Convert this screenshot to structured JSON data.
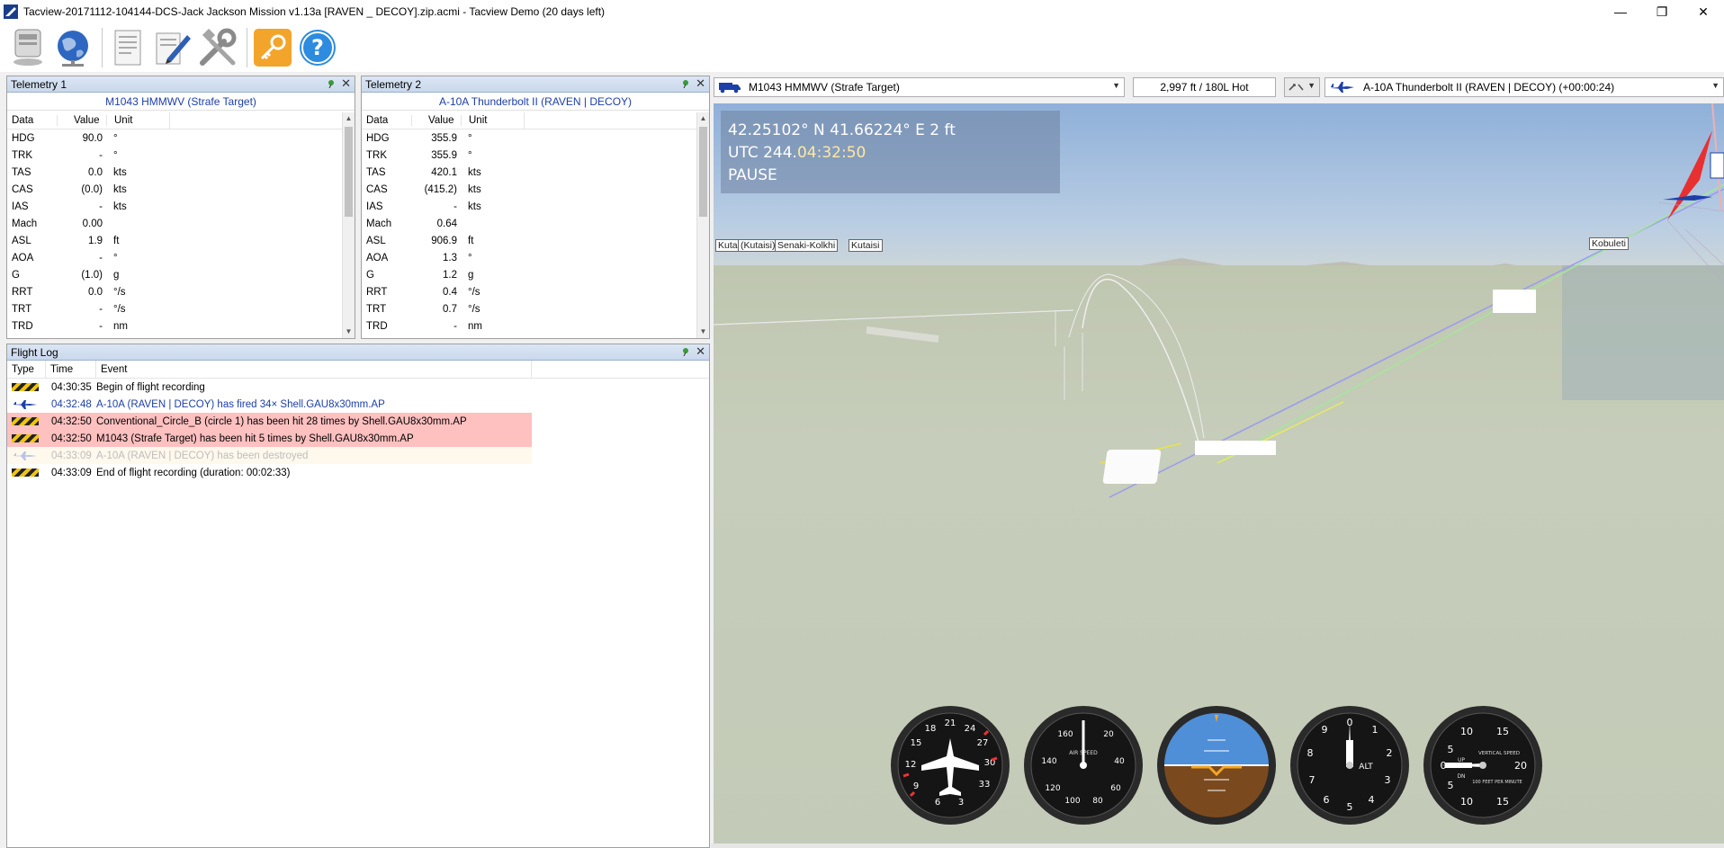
{
  "window": {
    "title": "Tacview-20171112-104144-DCS-Jack Jackson Mission v1.13a [RAVEN _ DECOY].zip.acmi - Tacview Demo (20 days left)",
    "minimize": "—",
    "restore": "❐",
    "close": "✕"
  },
  "toolbar": {
    "buttons": [
      "open-icon",
      "online-icon",
      "document-icon",
      "edit-icon",
      "tools-icon",
      "key-icon",
      "help-icon"
    ],
    "help_glyph": "?"
  },
  "telemetry1": {
    "title": "Telemetry 1",
    "object": "M1043 HMMWV (Strafe Target)",
    "headers": [
      "Data",
      "Value",
      "Unit"
    ],
    "rows": [
      [
        "HDG",
        "90.0",
        "°"
      ],
      [
        "TRK",
        "-",
        "°"
      ],
      [
        "TAS",
        "0.0",
        "kts"
      ],
      [
        "CAS",
        "(0.0)",
        "kts"
      ],
      [
        "IAS",
        "-",
        "kts"
      ],
      [
        "Mach",
        "0.00",
        ""
      ],
      [
        "ASL",
        "1.9",
        "ft"
      ],
      [
        "AOA",
        "-",
        "°"
      ],
      [
        "G",
        "(1.0)",
        "g"
      ],
      [
        "RRT",
        "0.0",
        "°/s"
      ],
      [
        "TRT",
        "-",
        "°/s"
      ],
      [
        "TRD",
        "-",
        "nm"
      ]
    ]
  },
  "telemetry2": {
    "title": "Telemetry 2",
    "object": "A-10A Thunderbolt II (RAVEN | DECOY)",
    "headers": [
      "Data",
      "Value",
      "Unit"
    ],
    "rows": [
      [
        "HDG",
        "355.9",
        "°"
      ],
      [
        "TRK",
        "355.9",
        "°"
      ],
      [
        "TAS",
        "420.1",
        "kts"
      ],
      [
        "CAS",
        "(415.2)",
        "kts"
      ],
      [
        "IAS",
        "-",
        "kts"
      ],
      [
        "Mach",
        "0.64",
        ""
      ],
      [
        "ASL",
        "906.9",
        "ft"
      ],
      [
        "AOA",
        "1.3",
        "°"
      ],
      [
        "G",
        "1.2",
        "g"
      ],
      [
        "RRT",
        "0.4",
        "°/s"
      ],
      [
        "TRT",
        "0.7",
        "°/s"
      ],
      [
        "TRD",
        "-",
        "nm"
      ]
    ]
  },
  "flightlog": {
    "title": "Flight Log",
    "headers": [
      "Type",
      "Time",
      "Event"
    ],
    "rows": [
      {
        "type": "hazard",
        "time": "04:30:35",
        "event": "Begin of flight recording",
        "style": ""
      },
      {
        "type": "plane",
        "time": "04:32:48",
        "event": "A-10A (RAVEN | DECOY) has fired 34× Shell.GAU8x30mm.AP",
        "style": "blue"
      },
      {
        "type": "hazard",
        "time": "04:32:50",
        "event": "Conventional_Circle_B (circle 1) has been hit 28 times by Shell.GAU8x30mm.AP",
        "style": "red"
      },
      {
        "type": "hazard",
        "time": "04:32:50",
        "event": "M1043 (Strafe Target) has been hit 5 times by Shell.GAU8x30mm.AP",
        "style": "red"
      },
      {
        "type": "plane-faded",
        "time": "04:33:09",
        "event": "A-10A (RAVEN | DECOY) has been destroyed",
        "style": "faded"
      },
      {
        "type": "hazard",
        "time": "04:33:09",
        "event": "End of flight recording (duration: 00:02:33)",
        "style": ""
      }
    ]
  },
  "viewbar": {
    "primary_object": "M1043 HMMWV (Strafe Target)",
    "distance": "2,997 ft / 180L Hot",
    "secondary_object": "A-10A Thunderbolt II (RAVEN | DECOY) (+00:00:24)"
  },
  "hud": {
    "coords": "42.25102° N  41.66224° E  2 ft",
    "utc_prefix": "UTC 244.",
    "utc_time": "04:32:50",
    "status": "PAUSE"
  },
  "map_labels": [
    "Kuta",
    "(Kutaisi)",
    "Senaki-Kolkhi",
    "Kutaisi",
    "Kobuleti"
  ],
  "gauges": {
    "heading_numbers": [
      "18",
      "21",
      "24",
      "27",
      "30",
      "33",
      "3",
      "6",
      "9",
      "12",
      "15"
    ],
    "airspeed_label": "AIR SPEED",
    "airspeed_numbers": [
      "160",
      "20",
      "140",
      "40",
      "120",
      "100",
      "80",
      "60"
    ],
    "altimeter_label": "ALT",
    "vsi_label_top": "VERTICAL SPEED",
    "vsi_label_bottom": "100 FEET PER MINUTE",
    "vsi_up": "UP",
    "vsi_dn": "DN"
  },
  "colors": {
    "link_blue": "#1c3fa8",
    "hit_red_bg": "#ffc0c0",
    "panel_header": "#c9d8ec"
  }
}
